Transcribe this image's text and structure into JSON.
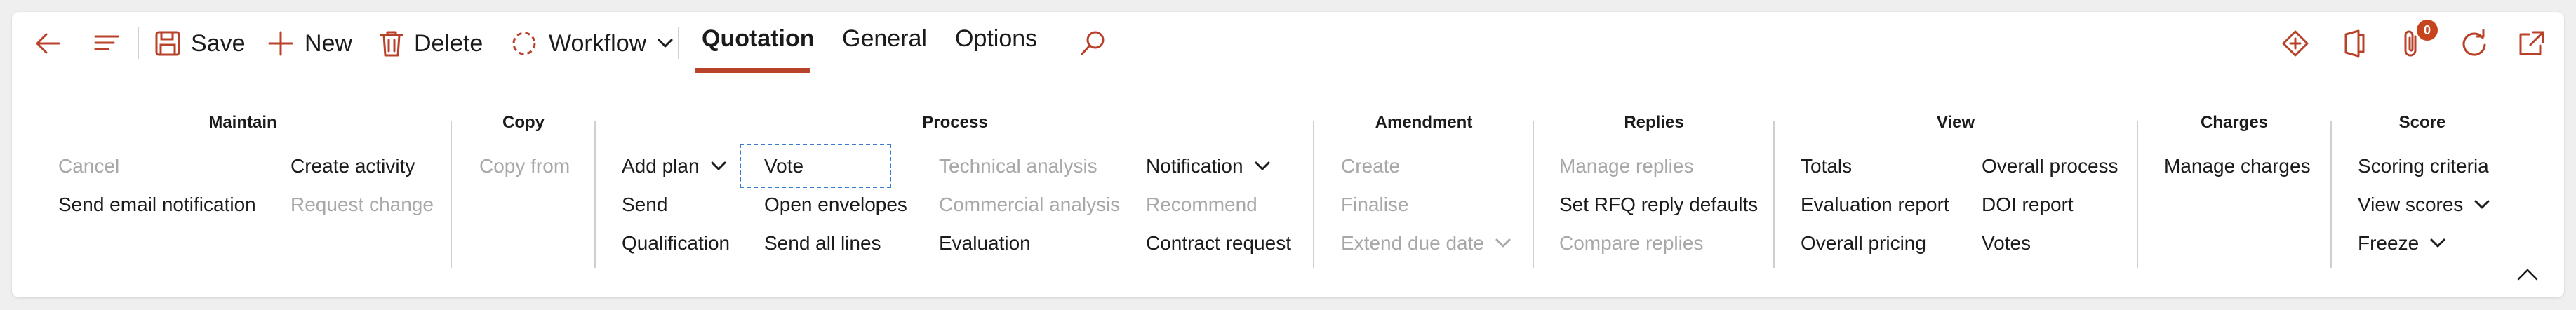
{
  "toolbar": {
    "save_label": "Save",
    "new_label": "New",
    "delete_label": "Delete",
    "workflow_label": "Workflow"
  },
  "tabs": [
    {
      "label": "Quotation",
      "active": true
    },
    {
      "label": "General",
      "active": false
    },
    {
      "label": "Options",
      "active": false
    }
  ],
  "notifications_count": "0",
  "accent_color": "#b8412a",
  "groups": {
    "maintain": {
      "title": "Maintain",
      "items": [
        "Cancel",
        "Send email notification",
        "Create activity",
        "Request change"
      ]
    },
    "copy": {
      "title": "Copy",
      "items": [
        "Copy from"
      ]
    },
    "process": {
      "title": "Process",
      "items": [
        "Add plan",
        "Send",
        "Qualification",
        "Vote",
        "Open envelopes",
        "Send all lines",
        "Technical analysis",
        "Commercial analysis",
        "Evaluation",
        "Notification",
        "Recommend",
        "Contract request"
      ]
    },
    "amendment": {
      "title": "Amendment",
      "items": [
        "Create",
        "Finalise",
        "Extend due date"
      ]
    },
    "replies": {
      "title": "Replies",
      "items": [
        "Manage replies",
        "Set RFQ reply defaults",
        "Compare replies"
      ]
    },
    "view": {
      "title": "View",
      "items": [
        "Totals",
        "Evaluation report",
        "Overall pricing",
        "Overall process",
        "DOI report",
        "Votes"
      ]
    },
    "charges": {
      "title": "Charges",
      "items": [
        "Manage charges"
      ]
    },
    "score": {
      "title": "Score",
      "items": [
        "Scoring criteria",
        "View scores",
        "Freeze"
      ]
    }
  }
}
